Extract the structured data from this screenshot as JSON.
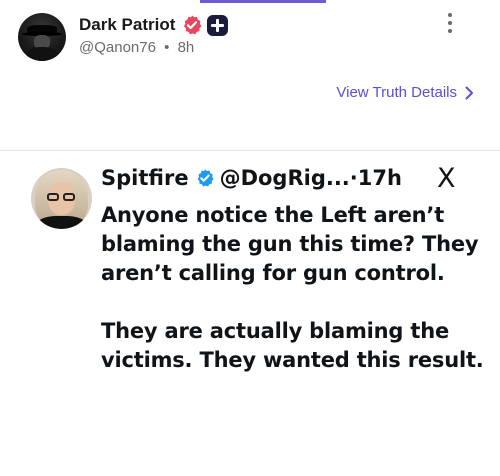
{
  "post": {
    "author": {
      "display_name": "Dark Patriot",
      "handle": "@Qanon76",
      "separator": "•",
      "time": "8h"
    },
    "view_details_label": "View Truth Details",
    "more_icon": "more-vertical-icon"
  },
  "embed": {
    "author": {
      "display_name": "Spitfire",
      "handle": "@DogRig...",
      "time": "·17h"
    },
    "platform_logo": "X",
    "text": {
      "paragraph_1": "Anyone notice the Left aren’t blaming the gun this time? They aren’t calling for gun control.",
      "paragraph_2": "They are actually blaming the victims. They wanted this result."
    }
  },
  "colors": {
    "accent_link": "#5b4fd0",
    "verified_pink": "#e8455f",
    "verified_blue": "#1d9bf0",
    "plus_badge": "#1b1b3a"
  }
}
